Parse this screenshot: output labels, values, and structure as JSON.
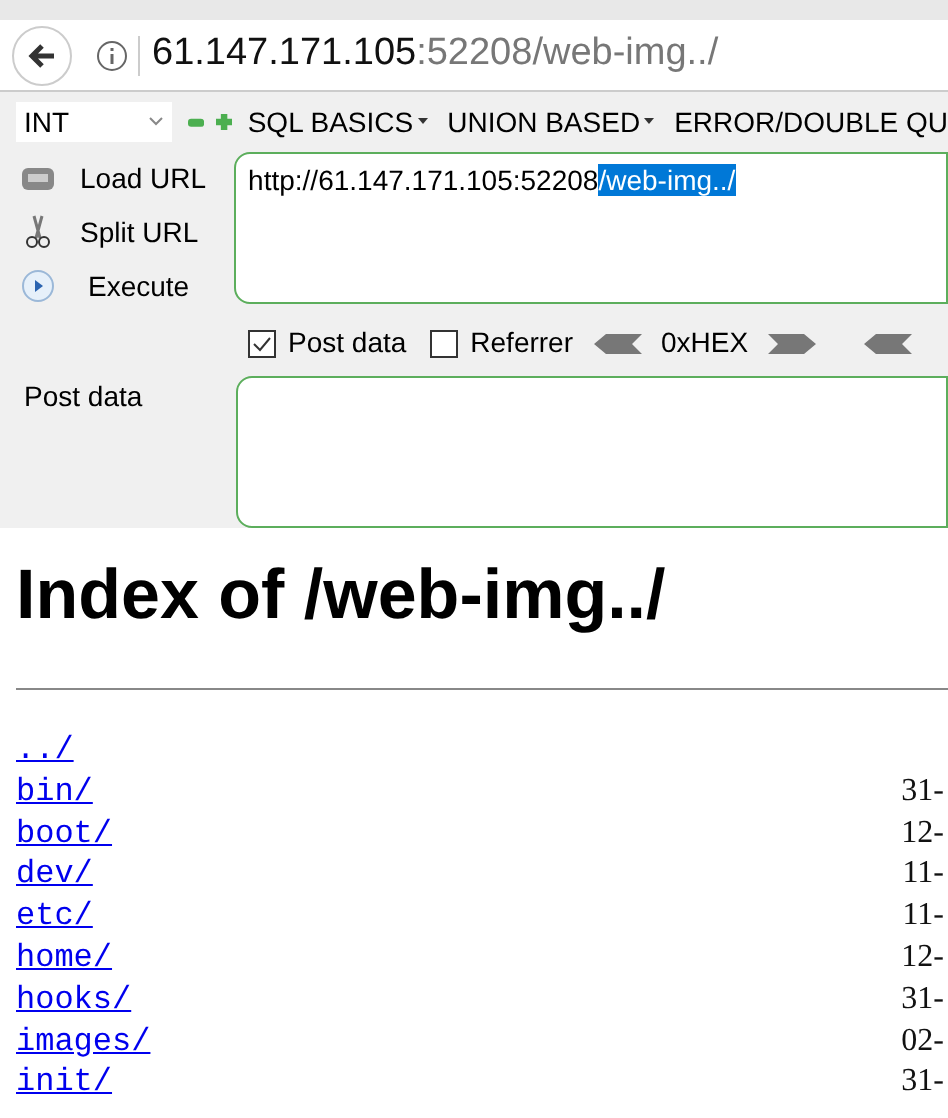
{
  "address_bar": {
    "host": "61.147.171.105",
    "rest": ":52208/web-img../"
  },
  "hackbar": {
    "type_select": "INT",
    "menus": [
      "SQL BASICS",
      "UNION BASED",
      "ERROR/DOUBLE QU"
    ],
    "actions": [
      {
        "kind": "load",
        "label": "Load URL"
      },
      {
        "kind": "split",
        "label": "Split URL"
      },
      {
        "kind": "execute",
        "label": "Execute"
      }
    ],
    "url_plain": "http://61.147.171.105:52208",
    "url_selected": "/web-img../",
    "options": [
      {
        "label": "Post data",
        "checked": true
      },
      {
        "label": "Referrer",
        "checked": false
      }
    ],
    "hex_label": "0xHEX",
    "post_label": "Post data"
  },
  "page": {
    "heading": "Index of /web-img../",
    "entries": [
      {
        "name": "../"
      },
      {
        "name": "bin/",
        "date": "31-"
      },
      {
        "name": "boot/",
        "date": "12-"
      },
      {
        "name": "dev/",
        "date": "11-"
      },
      {
        "name": "etc/",
        "date": "11-"
      },
      {
        "name": "home/",
        "date": "12-"
      },
      {
        "name": "hooks/",
        "date": "31-"
      },
      {
        "name": "images/",
        "date": "02-"
      },
      {
        "name": "init/",
        "date": "31-"
      }
    ]
  }
}
